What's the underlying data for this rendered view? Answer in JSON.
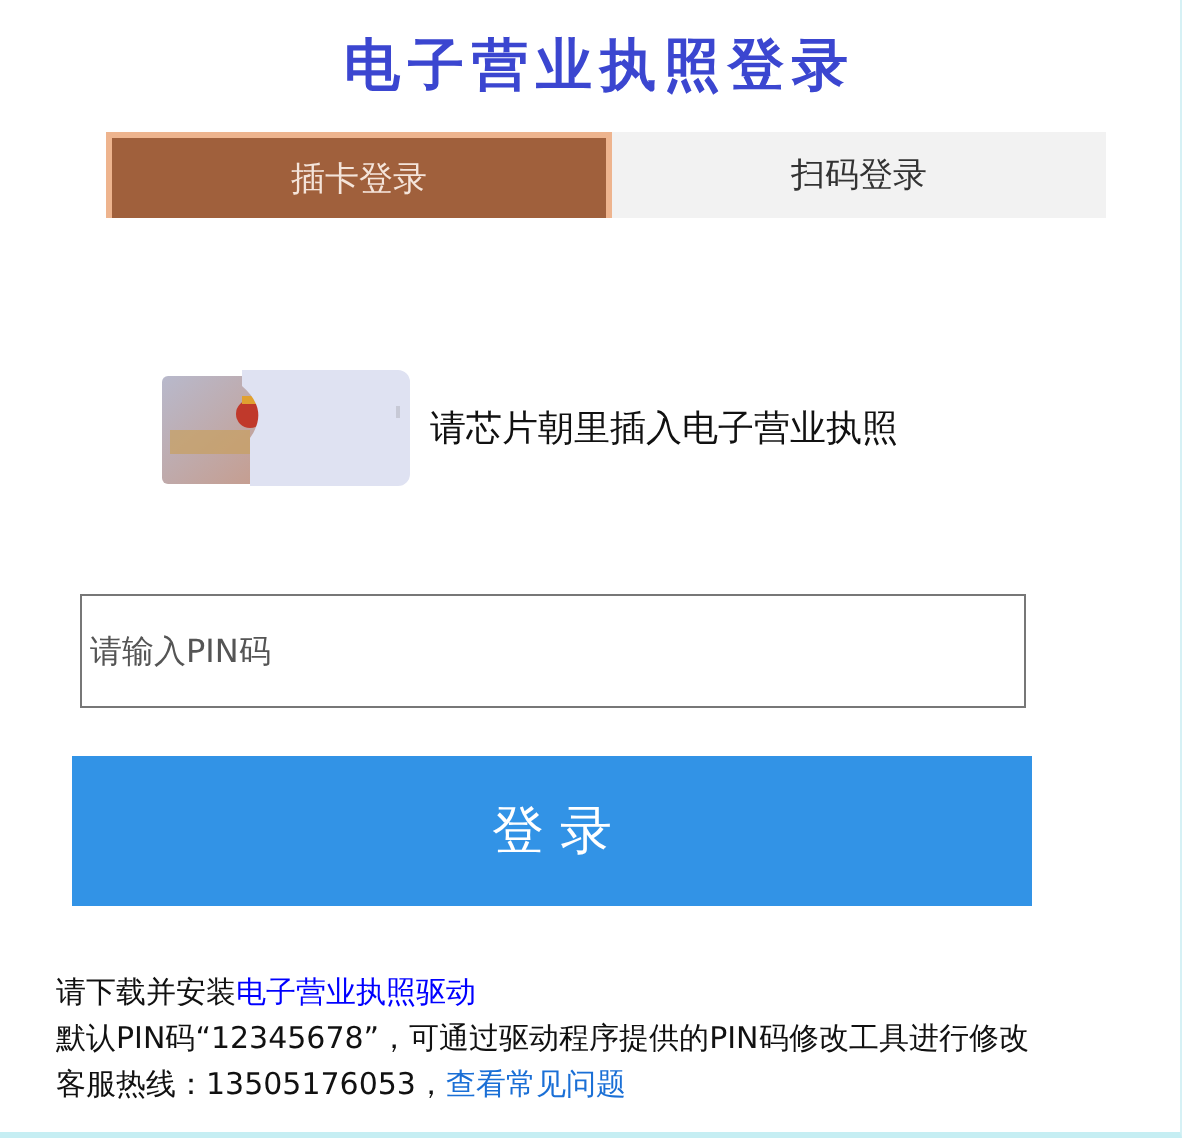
{
  "title": "电子营业执照登录",
  "tabs": [
    {
      "label": "插卡登录",
      "selected": true
    },
    {
      "label": "扫码登录",
      "selected": false
    }
  ],
  "card_panel": {
    "instruction": "请芯片朝里插入电子营业执照"
  },
  "pin_field": {
    "placeholder": "请输入PIN码"
  },
  "login_button": {
    "label": "登 录"
  },
  "notes": [
    {
      "text": "请下载并安装",
      "link": {
        "label": "电子营业执照驱动",
        "color": "#0000ff"
      }
    },
    {
      "text": "默认PIN码“12345678”，可通过驱动程序提供的PIN码修改工具进行修改"
    },
    {
      "text": "客服热线：13505176053，",
      "link": {
        "label": "查看常见问题",
        "color": "#1a6fd6"
      }
    }
  ]
}
